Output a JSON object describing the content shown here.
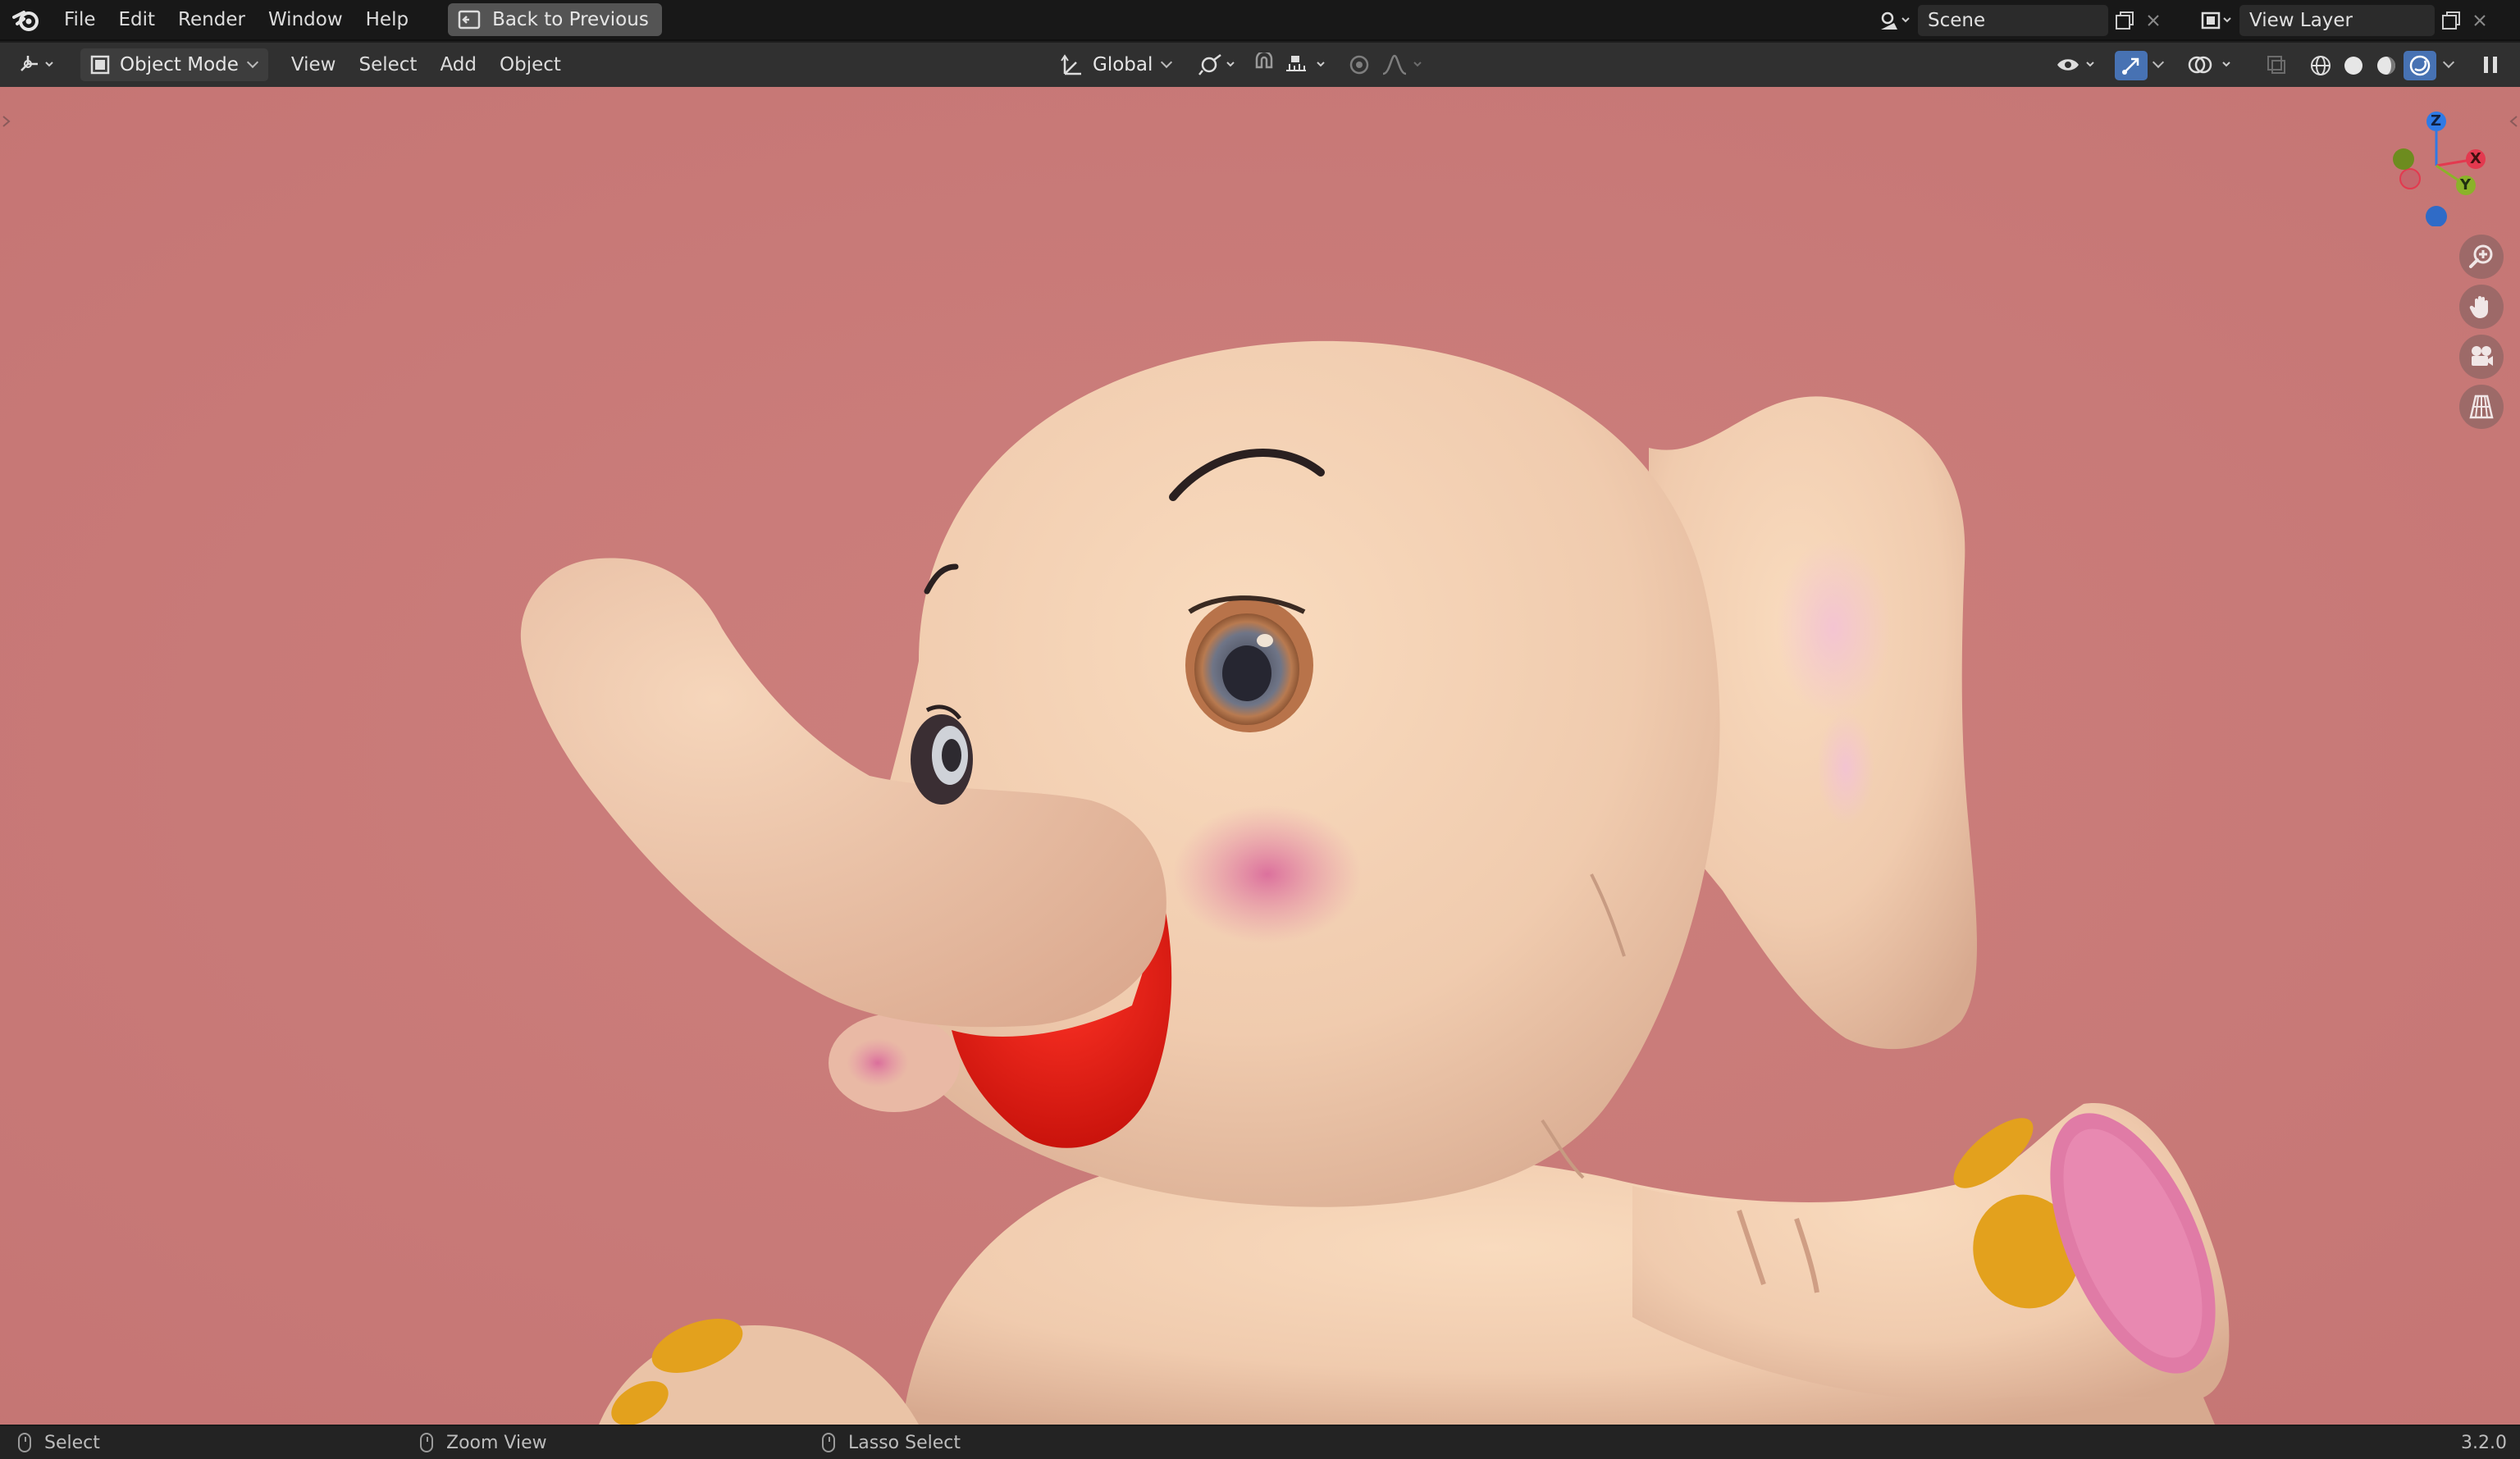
{
  "topbar": {
    "menu": [
      "File",
      "Edit",
      "Render",
      "Window",
      "Help"
    ],
    "back_button": "Back to Previous",
    "scene_name": "Scene",
    "view_layer_name": "View Layer"
  },
  "header": {
    "mode": "Object Mode",
    "menu": [
      "View",
      "Select",
      "Add",
      "Object"
    ],
    "transform_orientation": "Global"
  },
  "gizmo": {
    "z": "Z",
    "x": "X",
    "y": "Y"
  },
  "statusbar": {
    "left": "Select",
    "middle": "Zoom View",
    "right": "Lasso Select",
    "version": "3.2.0"
  },
  "colors": {
    "viewport_bg": "#c77978",
    "active_toggle": "#4772b3",
    "axis_x": "#e3394f",
    "axis_y": "#8bb22a",
    "axis_z": "#2f7ae5"
  }
}
